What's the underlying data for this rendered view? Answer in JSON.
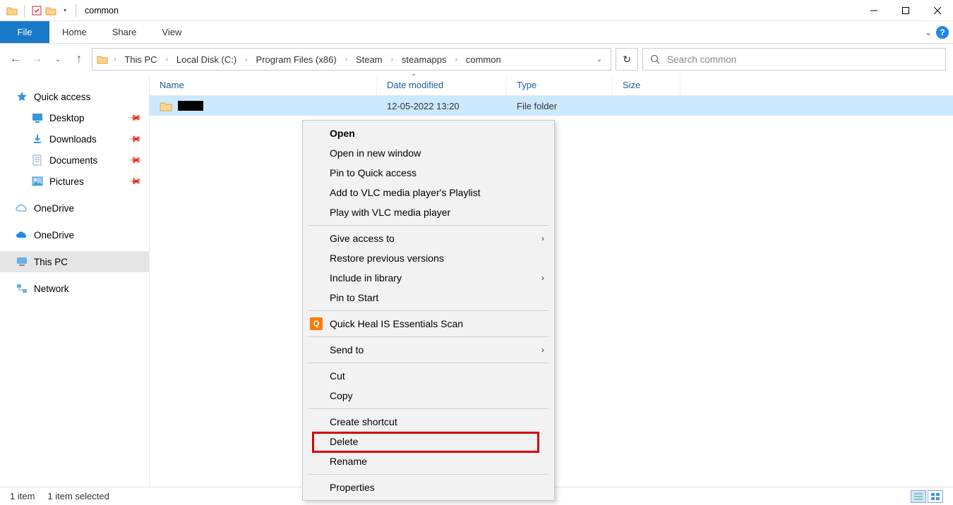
{
  "window": {
    "title": "common"
  },
  "ribbon": {
    "file": "File",
    "tabs": [
      "Home",
      "Share",
      "View"
    ]
  },
  "breadcrumb": [
    "This PC",
    "Local Disk (C:)",
    "Program Files (x86)",
    "Steam",
    "steamapps",
    "common"
  ],
  "search": {
    "placeholder": "Search common"
  },
  "nav": {
    "quick_access": "Quick access",
    "desktop": "Desktop",
    "downloads": "Downloads",
    "documents": "Documents",
    "pictures": "Pictures",
    "onedrive1": "OneDrive",
    "onedrive2": "OneDrive",
    "this_pc": "This PC",
    "network": "Network"
  },
  "columns": {
    "name": "Name",
    "date": "Date modified",
    "type": "Type",
    "size": "Size"
  },
  "row": {
    "date": "12-05-2022 13:20",
    "type": "File folder"
  },
  "context": {
    "open": "Open",
    "open_new": "Open in new window",
    "pin_quick": "Pin to Quick access",
    "add_vlc": "Add to VLC media player's Playlist",
    "play_vlc": "Play with VLC media player",
    "give_access": "Give access to",
    "restore": "Restore previous versions",
    "include_lib": "Include in library",
    "pin_start": "Pin to Start",
    "quickheal": "Quick Heal IS Essentials Scan",
    "send_to": "Send to",
    "cut": "Cut",
    "copy": "Copy",
    "create_shortcut": "Create shortcut",
    "delete": "Delete",
    "rename": "Rename",
    "properties": "Properties"
  },
  "status": {
    "count": "1 item",
    "selected": "1 item selected"
  }
}
